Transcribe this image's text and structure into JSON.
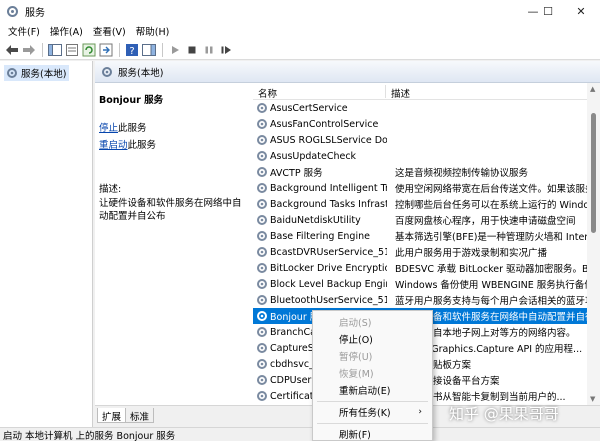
{
  "window": {
    "title": "服务",
    "controls": {
      "minimize": "—",
      "maximize": "☐",
      "close": "✕"
    }
  },
  "menu": [
    "文件(F)",
    "操作(A)",
    "查看(V)",
    "帮助(H)"
  ],
  "toolbar": {
    "icons": [
      "back-icon",
      "forward-icon",
      "console-tree-icon",
      "properties-icon",
      "refresh-icon",
      "export-icon",
      "help-icon",
      "show-hide-icon",
      "start-service-icon",
      "stop-service-icon",
      "pause-service-icon",
      "restart-service-icon"
    ]
  },
  "tree": {
    "root": "服务(本地)"
  },
  "pane_header": "服务(本地)",
  "details": {
    "service_title": "Bonjour 服务",
    "stop_link": "停止",
    "stop_suffix": "此服务",
    "restart_link": "重启动",
    "restart_suffix": "此服务",
    "desc_label": "描述:",
    "desc_text": "让硬件设备和软件服务在网络中自动配置并自公布"
  },
  "list": {
    "headers": {
      "name": "名称",
      "desc": "描述"
    },
    "rows": [
      {
        "name": "AsusCertService",
        "desc": ""
      },
      {
        "name": "AsusFanControlService",
        "desc": ""
      },
      {
        "name": "ASUS ROGLSLService Down...",
        "desc": ""
      },
      {
        "name": "AsusUpdateCheck",
        "desc": ""
      },
      {
        "name": "AVCTP 服务",
        "desc": "这是音频视频控制传输协议服务"
      },
      {
        "name": "Background Intelligent Tra...",
        "desc": "使用空闲网络带宽在后台传送文件。如果该服务..."
      },
      {
        "name": "Background Tasks Infrastru...",
        "desc": "控制哪些后台任务可以在系统上运行的 Windows"
      },
      {
        "name": "BaiduNetdiskUtility",
        "desc": "百度网盘核心程序，用于快速申请磁盘空间"
      },
      {
        "name": "Base Filtering Engine",
        "desc": "基本筛选引擎(BFE)是一种管理防火墙和 Internet ..."
      },
      {
        "name": "BcastDVRUserService_510...",
        "desc": "此用户服务用于游戏录制和实况广播"
      },
      {
        "name": "BitLocker Drive Encryption ...",
        "desc": "BDESVC 承载 BitLocker 驱动器加密服务。BitLo..."
      },
      {
        "name": "Block Level Backup Engine ...",
        "desc": "Windows 备份使用 WBENGINE 服务执行备份和..."
      },
      {
        "name": "BluetoothUserService_510...",
        "desc": "蓝牙用户服务支持与每个用户会话相关的蓝牙功..."
      },
      {
        "name": "Bonjour 服务",
        "desc": "让硬件设备和软件服务在网络中自动配置并自行..."
      },
      {
        "name": "BranchCa...",
        "desc": "服务将来自本地子网上对等方的网络内容。"
      },
      {
        "name": "CaptureSe...",
        "desc": "indows.Graphics.Capture API 的应用程..."
      },
      {
        "name": "cbdhsvc_5...",
        "desc": "务用于剪贴板方案"
      },
      {
        "name": "CDPUserS...",
        "desc": "务用于连接设备平台方案"
      },
      {
        "name": "Certificate...",
        "desc": "书和根证书从智能卡复制到当前用户的..."
      }
    ]
  },
  "tabs": [
    "扩展",
    "标准"
  ],
  "context_menu": {
    "items": [
      {
        "label": "启动(S)",
        "disabled": true
      },
      {
        "label": "停止(O)",
        "disabled": false
      },
      {
        "label": "暂停(U)",
        "disabled": true
      },
      {
        "label": "恢复(M)",
        "disabled": true
      },
      {
        "label": "重新启动(E)",
        "disabled": false
      },
      {
        "label": "所有任务(K)",
        "disabled": false,
        "submenu_arrow": "›"
      },
      {
        "label": "刷新(F)",
        "disabled": false
      }
    ]
  },
  "status": "启动 本地计算机 上的服务 Bonjour 服务",
  "watermark": "知乎 @果果哥哥",
  "colors": {
    "selection": "#0078d7",
    "link": "#0645ad"
  }
}
